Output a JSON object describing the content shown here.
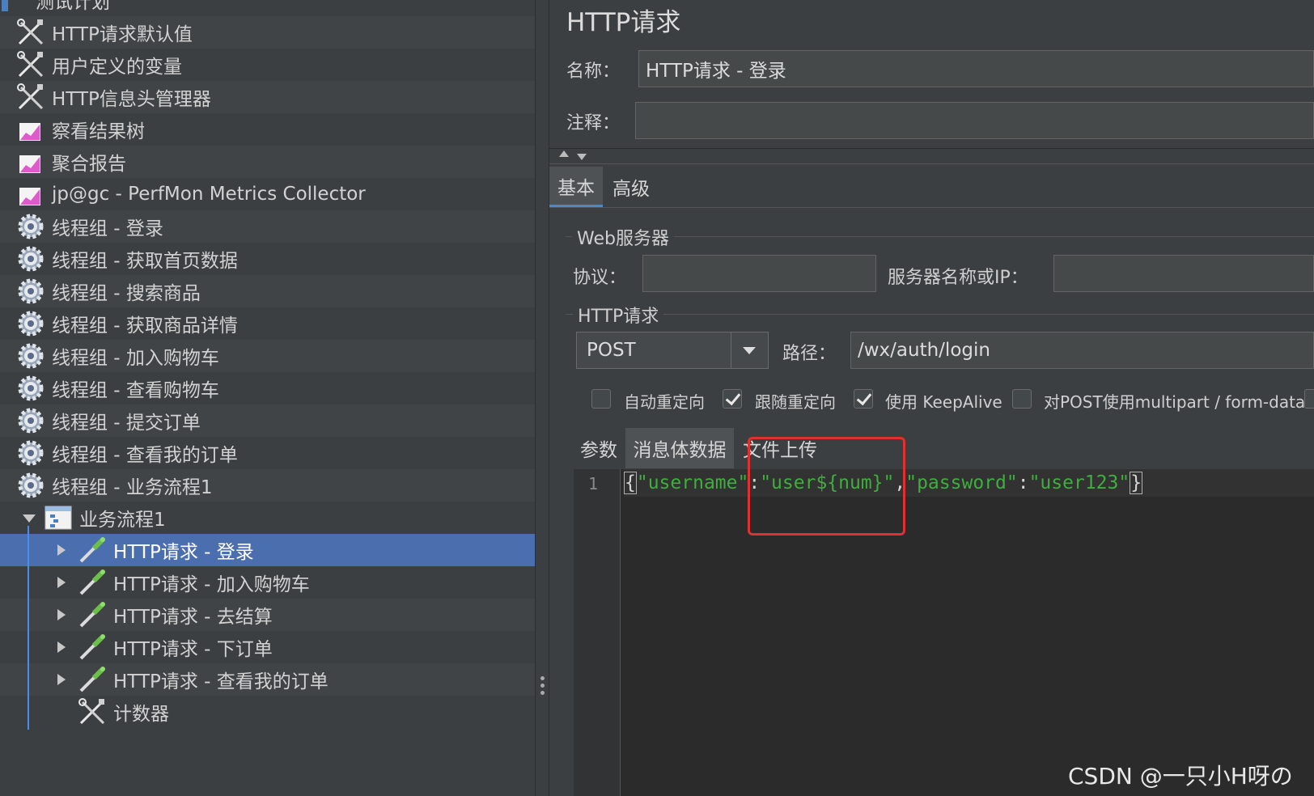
{
  "tree": {
    "items": [
      {
        "label": "测试计划",
        "icon": "test-plan-icon",
        "indent": 0
      },
      {
        "label": "HTTP请求默认值",
        "icon": "config-tools-icon",
        "indent": 1
      },
      {
        "label": "用户定义的变量",
        "icon": "config-tools-icon",
        "indent": 1
      },
      {
        "label": "HTTP信息头管理器",
        "icon": "config-tools-icon",
        "indent": 1
      },
      {
        "label": "察看结果树",
        "icon": "listener-chart-icon",
        "indent": 1
      },
      {
        "label": "聚合报告",
        "icon": "listener-chart-icon",
        "indent": 1
      },
      {
        "label": "jp@gc - PerfMon Metrics Collector",
        "icon": "listener-chart-icon",
        "indent": 1
      },
      {
        "label": "线程组 - 登录",
        "icon": "thread-group-gear-icon",
        "indent": 1
      },
      {
        "label": "线程组 - 获取首页数据",
        "icon": "thread-group-gear-icon",
        "indent": 1
      },
      {
        "label": "线程组 - 搜索商品",
        "icon": "thread-group-gear-icon",
        "indent": 1
      },
      {
        "label": "线程组 - 获取商品详情",
        "icon": "thread-group-gear-icon",
        "indent": 1
      },
      {
        "label": "线程组 - 加入购物车",
        "icon": "thread-group-gear-icon",
        "indent": 1
      },
      {
        "label": "线程组 - 查看购物车",
        "icon": "thread-group-gear-icon",
        "indent": 1
      },
      {
        "label": "线程组 - 提交订单",
        "icon": "thread-group-gear-icon",
        "indent": 1
      },
      {
        "label": "线程组 - 查看我的订单",
        "icon": "thread-group-gear-icon",
        "indent": 1
      },
      {
        "label": "线程组 - 业务流程1",
        "icon": "thread-group-gear-icon",
        "indent": 1
      },
      {
        "label": "业务流程1",
        "icon": "transaction-controller-icon",
        "indent": 2
      },
      {
        "label": "HTTP请求 - 登录",
        "icon": "http-sampler-pipette-icon",
        "indent": 3,
        "selected": true
      },
      {
        "label": "HTTP请求 - 加入购物车",
        "icon": "http-sampler-pipette-icon",
        "indent": 3
      },
      {
        "label": "HTTP请求 - 去结算",
        "icon": "http-sampler-pipette-icon",
        "indent": 3
      },
      {
        "label": "HTTP请求 - 下订单",
        "icon": "http-sampler-pipette-icon",
        "indent": 3
      },
      {
        "label": "HTTP请求 - 查看我的订单",
        "icon": "http-sampler-pipette-icon",
        "indent": 3
      },
      {
        "label": "计数器",
        "icon": "config-tools-icon",
        "indent": 3
      }
    ]
  },
  "panel": {
    "title": "HTTP请求",
    "name_label": "名称：",
    "name_value": "HTTP请求 - 登录",
    "comment_label": "注释：",
    "comment_value": "",
    "tabs": [
      "基本",
      "高级"
    ],
    "web_server_group": "Web服务器",
    "protocol_label": "协议：",
    "protocol_value": "",
    "server_label": "服务器名称或IP：",
    "server_value": "",
    "http_group": "HTTP请求",
    "method": "POST",
    "path_label": "路径：",
    "path_value": "/wx/auth/login",
    "checkboxes": [
      {
        "label": "自动重定向",
        "checked": false
      },
      {
        "label": "跟随重定向",
        "checked": true
      },
      {
        "label": "使用 KeepAlive",
        "checked": true
      },
      {
        "label": "对POST使用multipart / form-data",
        "checked": false
      }
    ],
    "sub_tabs": [
      "参数",
      "消息体数据",
      "文件上传"
    ],
    "line_number": "1",
    "body_tokens": [
      "{",
      "\"username\"",
      ":",
      "\"user${num}\"",
      ",",
      "\"password\"",
      ":",
      "\"user123\"",
      "}"
    ]
  },
  "watermark": "CSDN @一只小H呀の",
  "colors": {
    "background": "#3c3f41",
    "selection": "#4b6eaf",
    "string": "#3fae3f",
    "highlight_box": "#e03030"
  }
}
